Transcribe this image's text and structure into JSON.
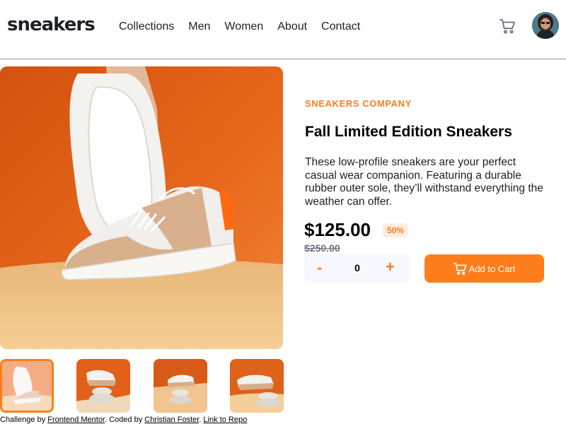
{
  "brand": {
    "logo": "sneakers"
  },
  "nav": {
    "items": [
      "Collections",
      "Men",
      "Women",
      "About",
      "Contact"
    ]
  },
  "product": {
    "company": "SNEAKERS COMPANY",
    "title": "Fall Limited Edition Sneakers",
    "description": "These low-profile sneakers are your perfect casual wear companion. Featuring a durable rubber outer sole, they’ll withstand everything the weather can offer.",
    "price": "$125.00",
    "discount": "50%",
    "old_price": "$250.00"
  },
  "cart": {
    "quantity": "0",
    "minus_label": "-",
    "plus_label": "+",
    "add_label": "Add to Cart"
  },
  "footer": {
    "prefix": "Challenge by ",
    "link1": "Frontend Mentor",
    "middle": ". Coded by ",
    "link2": "Christian Foster",
    "sep": ". ",
    "link3": "Link to Repo"
  },
  "colors": {
    "accent": "#ff7d1a",
    "accent_pale": "#ffede0",
    "dark": "#1d2026",
    "grey": "#6e7080",
    "light_bg": "#f6f8fd"
  },
  "icons": {
    "cart": "cart-icon",
    "avatar": "avatar"
  }
}
